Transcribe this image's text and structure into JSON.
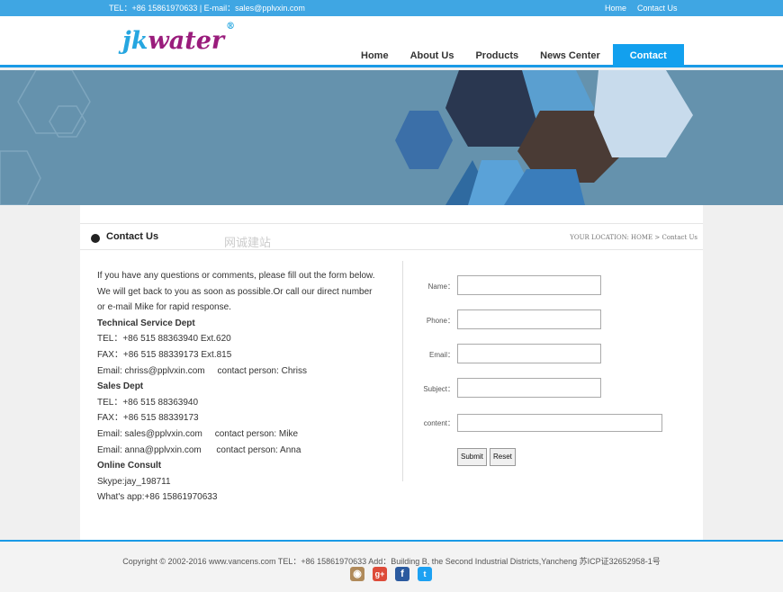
{
  "topbar": {
    "info": "TEL：+86 15861970633  | E-mail：sales@pplvxin.com",
    "links": [
      "Home",
      "Contact Us"
    ]
  },
  "logo": {
    "text_a": "jk",
    "text_b": "water",
    "reg": "®"
  },
  "nav": [
    "Home",
    "About Us",
    "Products",
    "News Center",
    "Contact Us"
  ],
  "section": {
    "title": "Contact Us",
    "location": "YOUR LOCATION:  HOME > Contact Us",
    "watermark": "网诚建站"
  },
  "contact": {
    "intro": [
      "If you have any questions or comments, please fill out the form below.",
      "We will get back to you as soon as possible.Or call our direct number",
      "or e-mail Mike for rapid response."
    ],
    "lines": [
      {
        "text": "Technical Service Dept",
        "bold": true
      },
      {
        "text": "TEL：+86 515 88363940 Ext.620"
      },
      {
        "text": "FAX：+86 515 88339173 Ext.815"
      },
      {
        "text": "Email: chriss@pplvxin.com     contact person: Chriss"
      },
      {
        "text": "Sales Dept",
        "bold": true
      },
      {
        "text": "TEL：+86 515 88363940"
      },
      {
        "text": "FAX：+86 515 88339173"
      },
      {
        "text": "Email: sales@pplvxin.com     contact person: Mike"
      },
      {
        "text": "Email: anna@pplvxin.com      contact person: Anna"
      },
      {
        "text": "Online Consult",
        "bold": true
      },
      {
        "text": "Skype:jay_198711"
      },
      {
        "text": "What's app:+86 15861970633"
      }
    ]
  },
  "form": {
    "name": "Name：",
    "phone": "Phone：",
    "email": "Email：",
    "subject": "Subject：",
    "content": "content：",
    "submit": "Submit",
    "reset": "Reset"
  },
  "footer": {
    "copyright": "Copyright © 2002-2016 www.vancens.com TEL：+86 15861970633 Add：Building B, the Second Industrial Districts,Yancheng 苏ICP证32652958-1号",
    "social": [
      "instagram-icon",
      "google-plus-icon",
      "facebook-icon",
      "twitter-icon"
    ]
  }
}
